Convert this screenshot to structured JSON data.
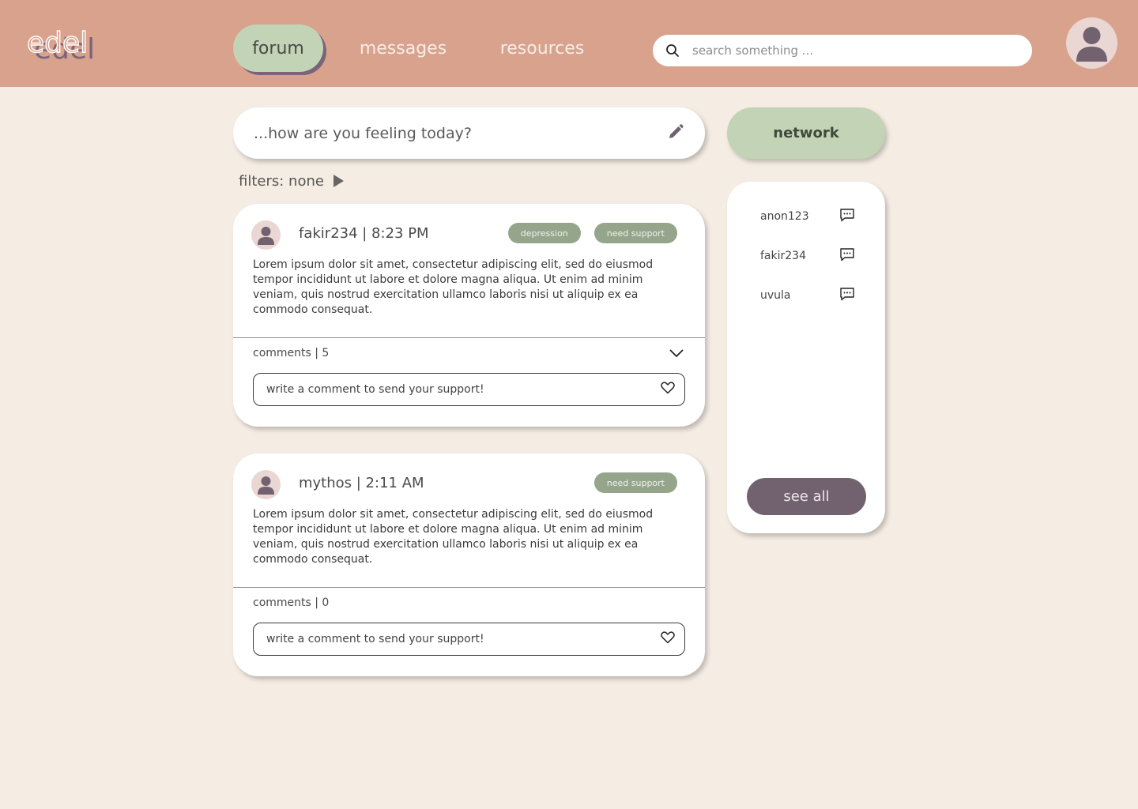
{
  "app": {
    "logo": "edel"
  },
  "nav": {
    "tabs": [
      {
        "label": "forum"
      },
      {
        "label": "messages"
      },
      {
        "label": "resources"
      }
    ]
  },
  "search": {
    "placeholder": "search something ..."
  },
  "compose": {
    "prompt": "...how are you feeling today?"
  },
  "filters": {
    "label": "filters: none"
  },
  "posts": [
    {
      "author_line": "fakir234  |  8:23 PM",
      "tags": [
        "depression",
        "need support"
      ],
      "body": "Lorem ipsum dolor sit amet, consectetur adipiscing elit, sed do eiusmod tempor incididunt ut labore et dolore magna aliqua. Ut enim ad minim veniam, quis nostrud exercitation ullamco laboris nisi ut aliquip ex ea commodo consequat.",
      "comments": "comments | 5",
      "comment_placeholder": "write a comment to send your support!"
    },
    {
      "author_line": "mythos |  2:11 AM",
      "tags": [
        "need support"
      ],
      "body": "Lorem ipsum dolor sit amet, consectetur adipiscing elit, sed do eiusmod tempor incididunt ut labore et dolore magna aliqua. Ut enim ad minim veniam, quis nostrud exercitation ullamco laboris nisi ut aliquip ex ea commodo consequat.",
      "comments": "comments | 0",
      "comment_placeholder": "write a comment to send your support!"
    }
  ],
  "network": {
    "title": "network",
    "users": [
      {
        "name": "anon123"
      },
      {
        "name": "fakir234"
      },
      {
        "name": "uvula"
      }
    ],
    "see_all": "see all"
  },
  "colors": {
    "header": "#D9A28D",
    "background": "#F5EDE4",
    "sage": "#C2D3B6",
    "tag": "#95A58C",
    "plum": "#72626F"
  }
}
